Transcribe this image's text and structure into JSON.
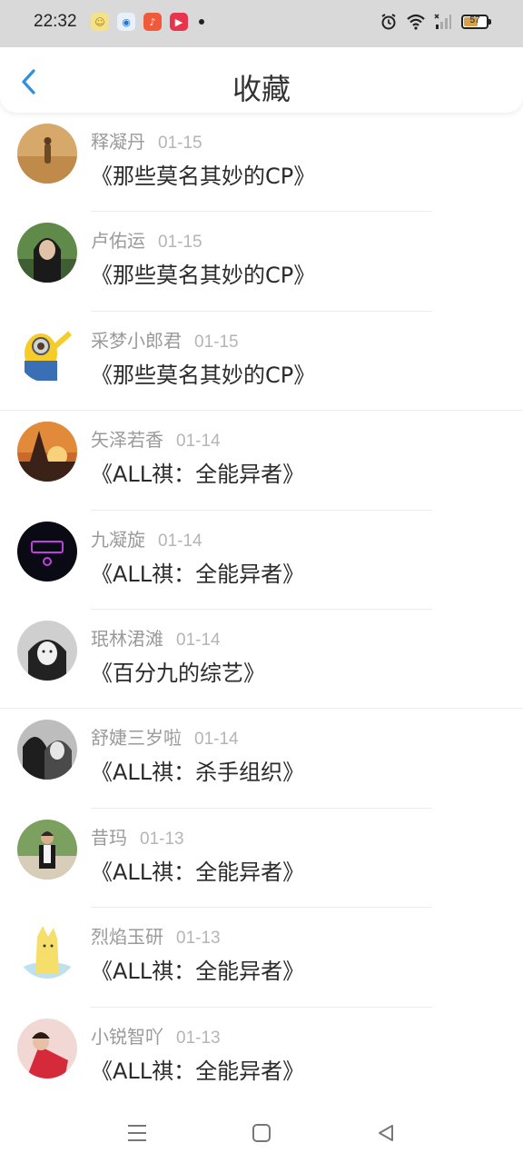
{
  "status_bar": {
    "time": "22:32",
    "battery": "57",
    "battery_level": 0.57,
    "notification_icons": [
      "weather-app-icon",
      "browser-app-icon",
      "music-app-icon",
      "video-app-icon"
    ],
    "system_icons": [
      "alarm-icon",
      "wifi-icon",
      "signal-icon",
      "battery-icon"
    ]
  },
  "header": {
    "title": "收藏",
    "back_icon": "chevron-left-icon",
    "accent_color": "#2f8fe0"
  },
  "favorites": [
    {
      "user": "释凝丹",
      "date": "01-15",
      "book": "《那些莫名其妙的CP》"
    },
    {
      "user": "卢佑运",
      "date": "01-15",
      "book": "《那些莫名其妙的CP》"
    },
    {
      "user": "采梦小郎君",
      "date": "01-15",
      "book": "《那些莫名其妙的CP》"
    },
    {
      "user": "矢泽若香",
      "date": "01-14",
      "book": "《ALL祺：全能异者》"
    },
    {
      "user": "九凝旋",
      "date": "01-14",
      "book": "《ALL祺：全能异者》"
    },
    {
      "user": "珉林涒滩",
      "date": "01-14",
      "book": "《百分九的综艺》"
    },
    {
      "user": "舒婕三岁啦",
      "date": "01-14",
      "book": "《ALL祺：杀手组织》"
    },
    {
      "user": "昔玛",
      "date": "01-13",
      "book": "《ALL祺：全能异者》"
    },
    {
      "user": "烈焰玉研",
      "date": "01-13",
      "book": "《ALL祺：全能异者》"
    },
    {
      "user": "小锐智吖",
      "date": "01-13",
      "book": "《ALL祺：全能异者》"
    }
  ],
  "nav_bar": {
    "icons": [
      "menu-icon",
      "home-square-icon",
      "back-triangle-icon"
    ]
  }
}
